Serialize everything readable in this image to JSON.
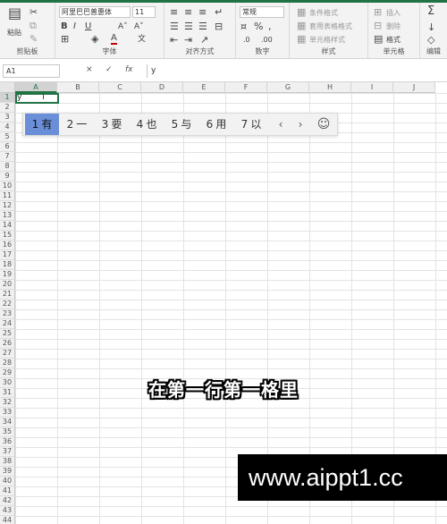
{
  "ribbon": {
    "clipboard": {
      "paste_label": "粘贴",
      "group_label": "剪贴板"
    },
    "font": {
      "font_name": "阿里巴巴普惠体",
      "font_size": "11",
      "group_label": "字体"
    },
    "alignment": {
      "group_label": "对齐方式"
    },
    "number": {
      "format_value": "常规",
      "group_label": "数字"
    },
    "styles": {
      "conditional_label": "条件格式",
      "table_format_label": "套用表格格式",
      "cell_style_label": "单元格样式",
      "group_label": "样式"
    },
    "cells": {
      "insert_label": "插入",
      "delete_label": "删除",
      "format_label": "格式",
      "group_label": "单元格"
    },
    "editing": {
      "group_label": "编辑"
    }
  },
  "formula_bar": {
    "name_box": "A1",
    "cancel_icon": "×",
    "confirm_icon": "✓",
    "fx_icon": "fx",
    "content": "y"
  },
  "sheet": {
    "columns": [
      "A",
      "B",
      "C",
      "D",
      "E",
      "F",
      "G",
      "H",
      "I",
      "J"
    ],
    "rows": [
      "1",
      "2",
      "3",
      "4",
      "5",
      "6",
      "7",
      "8",
      "9",
      "10",
      "11",
      "12",
      "13",
      "14",
      "15",
      "16",
      "17",
      "18",
      "19",
      "20",
      "21",
      "22",
      "23",
      "24",
      "25",
      "26",
      "27",
      "28",
      "29",
      "30",
      "31",
      "32",
      "33",
      "34",
      "35",
      "36",
      "37",
      "38",
      "39",
      "40",
      "41",
      "42",
      "43",
      "44"
    ],
    "active_cell_text": "y"
  },
  "ime": {
    "candidates": [
      {
        "index": "1",
        "text": "有"
      },
      {
        "index": "2",
        "text": "一"
      },
      {
        "index": "3",
        "text": "要"
      },
      {
        "index": "4",
        "text": "也"
      },
      {
        "index": "5",
        "text": "与"
      },
      {
        "index": "6",
        "text": "用"
      },
      {
        "index": "7",
        "text": "以"
      }
    ],
    "prev_icon": "‹",
    "next_icon": "›",
    "emoji_icon": "☺"
  },
  "caption": "在第一行第一格里",
  "watermark": "www.aippt1.cc",
  "colors": {
    "accent": "#217346",
    "candidate_highlight": "#6a8fd8"
  }
}
